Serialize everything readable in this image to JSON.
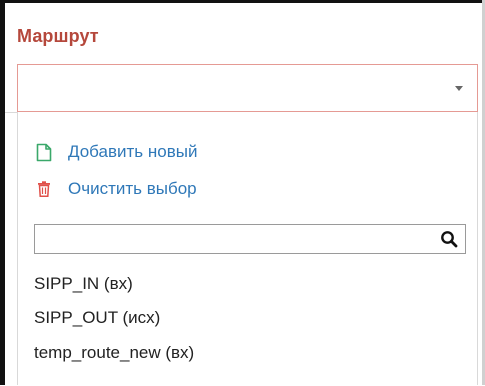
{
  "field": {
    "label": "Маршрут",
    "selected_value": ""
  },
  "dropdown": {
    "actions": [
      {
        "label": "Добавить новый",
        "icon": "document-add-icon",
        "color": "#3aa86a"
      },
      {
        "label": "Очистить выбор",
        "icon": "trash-icon",
        "color": "#e0504a"
      }
    ],
    "search": {
      "value": "",
      "placeholder": ""
    },
    "options": [
      {
        "label": "SIPP_IN (вх)"
      },
      {
        "label": "SIPP_OUT (исх)"
      },
      {
        "label": "temp_route_new (вх)"
      }
    ]
  },
  "colors": {
    "label": "#b5483c",
    "select_border": "#e59a94",
    "link": "#2f78b8"
  }
}
